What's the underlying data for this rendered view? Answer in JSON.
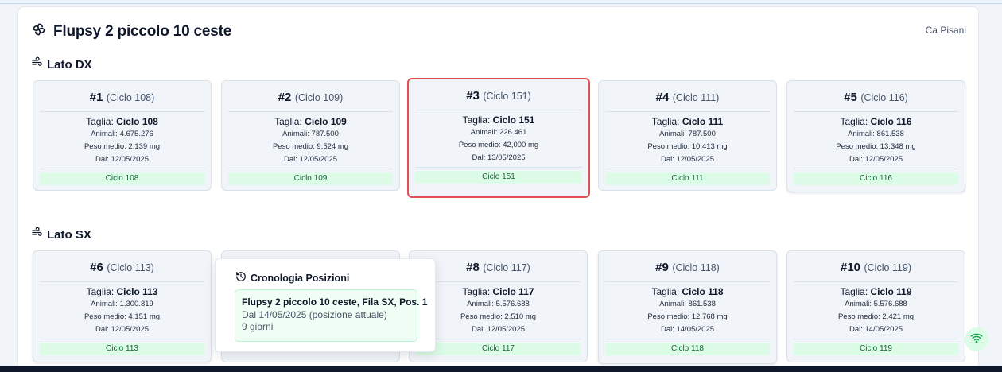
{
  "flupsy": {
    "title": "Flupsy 2 piccolo 10 ceste",
    "owner": "Ca Pisani"
  },
  "sides": {
    "dx": {
      "label": "Lato DX",
      "baskets": [
        {
          "num": "#1",
          "cycle": "(Ciclo 108)",
          "taglia_label": "Taglia:",
          "taglia": "Ciclo 108",
          "animali": "Animali: 4.675.276",
          "peso": "Peso medio: 2.139 mg",
          "dal": "Dal: 12/05/2025",
          "badge": "Ciclo 108"
        },
        {
          "num": "#2",
          "cycle": "(Ciclo 109)",
          "taglia_label": "Taglia:",
          "taglia": "Ciclo 109",
          "animali": "Animali: 787.500",
          "peso": "Peso medio: 9.524 mg",
          "dal": "Dal: 12/05/2025",
          "badge": "Ciclo 109"
        },
        {
          "num": "#3",
          "cycle": "(Ciclo 151)",
          "taglia_label": "Taglia:",
          "taglia": "Ciclo 151",
          "animali": "Animali: 226.461",
          "peso": "Peso medio: 42,000 mg",
          "dal": "Dal: 13/05/2025",
          "badge": "Ciclo 151"
        },
        {
          "num": "#4",
          "cycle": "(Ciclo 111)",
          "taglia_label": "Taglia:",
          "taglia": "Ciclo 111",
          "animali": "Animali: 787.500",
          "peso": "Peso medio: 10.413 mg",
          "dal": "Dal: 12/05/2025",
          "badge": "Ciclo 111"
        },
        {
          "num": "#5",
          "cycle": "(Ciclo 116)",
          "taglia_label": "Taglia:",
          "taglia": "Ciclo 116",
          "animali": "Animali: 861.538",
          "peso": "Peso medio: 13.348 mg",
          "dal": "Dal: 12/05/2025",
          "badge": "Ciclo 116"
        }
      ]
    },
    "sx": {
      "label": "Lato SX",
      "baskets": [
        {
          "num": "#6",
          "cycle": "(Ciclo 113)",
          "taglia_label": "Taglia:",
          "taglia": "Ciclo 113",
          "animali": "Animali: 1.300.819",
          "peso": "Peso medio: 4.151 mg",
          "dal": "Dal: 12/05/2025",
          "badge": "Ciclo 113"
        },
        {
          "num": "#8",
          "cycle": "(Ciclo 117)",
          "taglia_label": "Taglia:",
          "taglia": "Ciclo 117",
          "animali": "Animali: 5.576.688",
          "peso": "Peso medio: 2.510 mg",
          "dal": "Dal: 12/05/2025",
          "badge": "Ciclo 117"
        },
        {
          "num": "#9",
          "cycle": "(Ciclo 118)",
          "taglia_label": "Taglia:",
          "taglia": "Ciclo 118",
          "animali": "Animali: 861.538",
          "peso": "Peso medio: 12.768 mg",
          "dal": "Dal: 14/05/2025",
          "badge": "Ciclo 118"
        },
        {
          "num": "#10",
          "cycle": "(Ciclo 119)",
          "taglia_label": "Taglia:",
          "taglia": "Ciclo 119",
          "animali": "Animali: 5.576.688",
          "peso": "Peso medio: 2.421 mg",
          "dal": "Dal: 14/05/2025",
          "badge": "Ciclo 119"
        }
      ]
    }
  },
  "popup": {
    "title": "Cronologia Posizioni",
    "entry": {
      "location": "Flupsy 2 piccolo 10 ceste, Fila SX, Pos. 1",
      "since": "Dal 14/05/2025 (posizione attuale)",
      "duration": "9 giorni"
    }
  },
  "icons": {
    "title": "flupsy-icon",
    "side": "wind-icon",
    "popup": "history-icon",
    "fab": "wifi-icon"
  },
  "colors": {
    "selected_border": "#e05252",
    "badge_bg": "#dcfce7",
    "badge_text": "#166534"
  }
}
